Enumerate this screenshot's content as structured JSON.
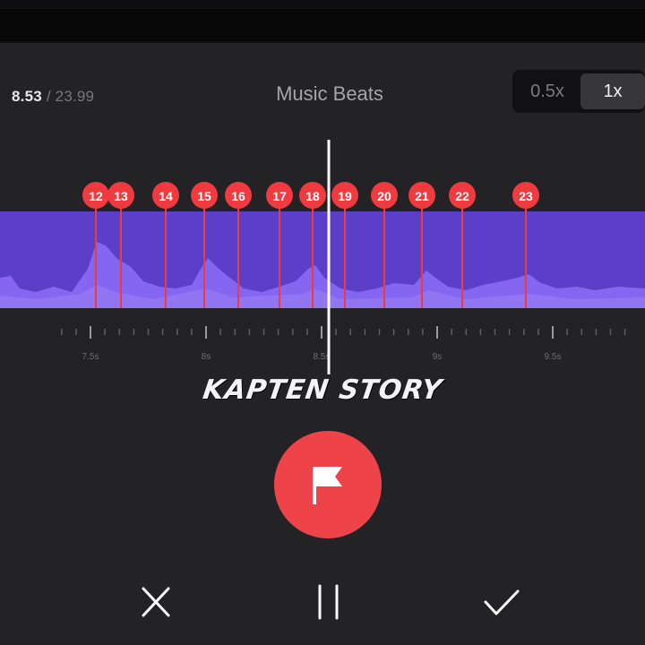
{
  "header": {
    "current_time": "8.53",
    "separator": " / ",
    "total_time": "23.99",
    "title": "Music Beats",
    "speed_options": [
      "0.5x",
      "1x"
    ],
    "selected_speed": "1x"
  },
  "timeline": {
    "beat_markers": [
      "12",
      "13",
      "14",
      "15",
      "16",
      "17",
      "18",
      "19",
      "20",
      "21",
      "22",
      "23"
    ],
    "tick_labels": [
      "7.5s",
      "8s",
      "8.5s",
      "9s",
      "9.5s"
    ]
  },
  "brand": {
    "text": "KAPTEN STORY"
  },
  "controls": {
    "flag_icon": "flag-icon",
    "close_icon": "close-icon",
    "pause_icon": "pause-icon",
    "confirm_icon": "checkmark-icon"
  },
  "colors": {
    "background": "#232326",
    "waveform_track": "#5b3fc8",
    "waveform_peaks": "#8566f0",
    "beat_marker": "#ef3b3f",
    "flag_button": "#ee4449",
    "playhead": "#ffffff"
  }
}
